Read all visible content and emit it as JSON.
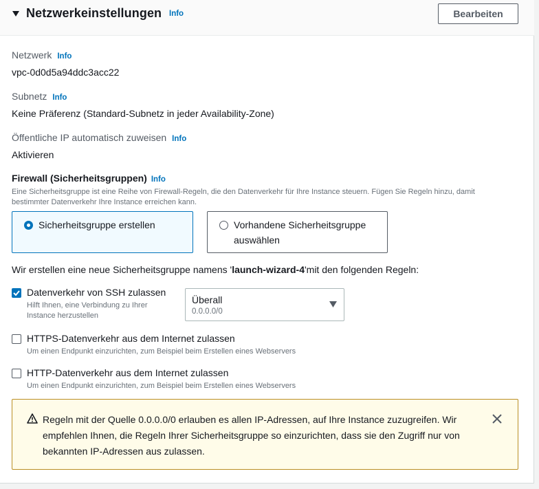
{
  "section": {
    "title": "Netzwerkeinstellungen",
    "info": "Info",
    "edit_button": "Bearbeiten"
  },
  "fields": {
    "network": {
      "label": "Netzwerk",
      "info": "Info",
      "value": "vpc-0d0d5a94ddc3acc22"
    },
    "subnet": {
      "label": "Subnetz",
      "info": "Info",
      "value": "Keine Präferenz (Standard-Subnetz in jeder Availability-Zone)"
    },
    "public_ip": {
      "label": "Öffentliche IP automatisch zuweisen",
      "info": "Info",
      "value": "Aktivieren"
    }
  },
  "firewall": {
    "title": "Firewall (Sicherheitsgruppen)",
    "info": "Info",
    "description": "Eine Sicherheitsgruppe ist eine Reihe von Firewall-Regeln, die den Datenverkehr für Ihre Instance steuern. Fügen Sie Regeln hinzu, damit bestimmter Datenverkehr Ihre Instance erreichen kann.",
    "options": [
      {
        "label": "Sicherheitsgruppe erstellen",
        "selected": true
      },
      {
        "label": "Vorhandene Sicherheitsgruppe auswählen",
        "selected": false
      }
    ],
    "sentence_prefix": "Wir erstellen eine neue Sicherheitsgruppe namens '",
    "group_name": "launch-wizard-4",
    "sentence_suffix": "'mit den folgenden Regeln:"
  },
  "rules": [
    {
      "label": "Datenverkehr von SSH zulassen",
      "description": "Hilft Ihnen, eine Verbindung zu Ihrer Instance herzustellen",
      "checked": true,
      "source_select": {
        "value": "Überall",
        "sub": "0.0.0.0/0"
      }
    },
    {
      "label": "HTTPS-Datenverkehr aus dem Internet zulassen",
      "description": "Um einen Endpunkt einzurichten, zum Beispiel beim Erstellen eines Webservers",
      "checked": false
    },
    {
      "label": "HTTP-Datenverkehr aus dem Internet zulassen",
      "description": "Um einen Endpunkt einzurichten, zum Beispiel beim Erstellen eines Webservers",
      "checked": false
    }
  ],
  "alert": {
    "type": "warning",
    "text": "Regeln mit der Quelle 0.0.0.0/0 erlauben es allen IP-Adressen, auf Ihre Instance zuzugreifen. Wir empfehlen Ihnen, die Regeln Ihrer Sicherheitsgruppe so einzurichten, dass sie den Zugriff nur von bekannten IP-Adressen aus zulassen."
  },
  "colors": {
    "accent": "#0073bb",
    "warning_border": "#ba8e23",
    "warning_background": "#fffce9"
  }
}
